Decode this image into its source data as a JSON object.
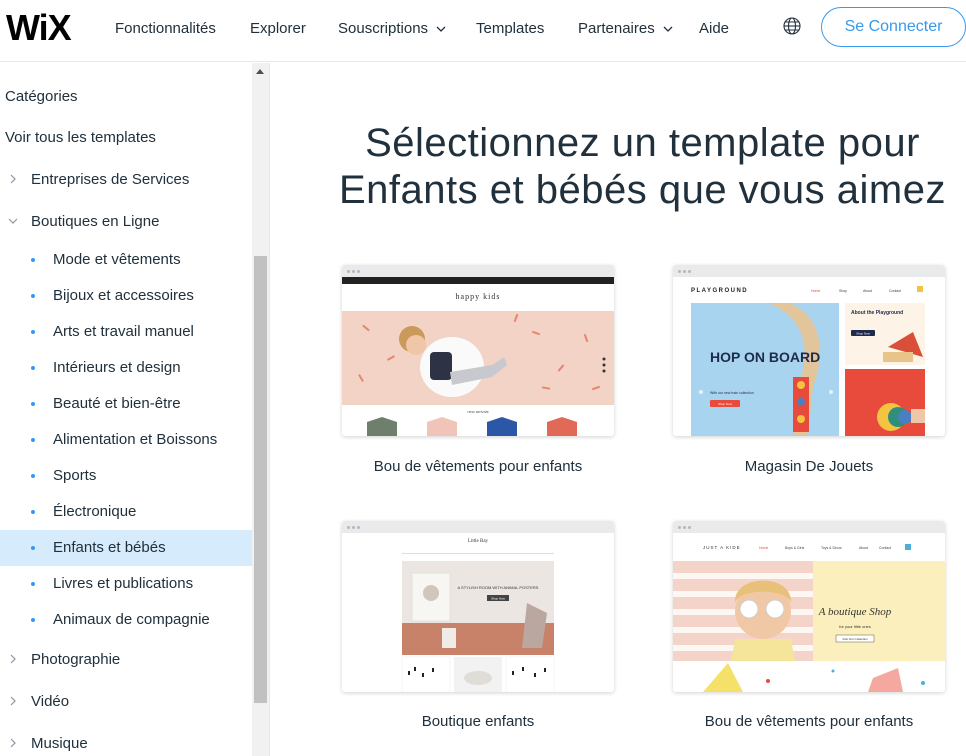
{
  "header": {
    "logo_text": "WiX",
    "nav": [
      "Fonctionnalités",
      "Explorer",
      "Souscriptions",
      "Templates",
      "Partenaires",
      "Aide"
    ],
    "connect_label": "Se Connecter"
  },
  "sidebar": {
    "categories_title": "Catégories",
    "all_templates": "Voir tous les templates",
    "items": [
      {
        "label": "Entreprises de Services",
        "expanded": false
      },
      {
        "label": "Boutiques en Ligne",
        "expanded": true
      },
      {
        "label": "Photographie",
        "expanded": false
      },
      {
        "label": "Vidéo",
        "expanded": false
      },
      {
        "label": "Musique",
        "expanded": false
      }
    ],
    "subitems": [
      "Mode et vêtements",
      "Bijoux et accessoires",
      "Arts et travail manuel",
      "Intérieurs et design",
      "Beauté et bien-être",
      "Alimentation et Boissons",
      "Sports",
      "Électronique",
      "Enfants et bébés",
      "Livres et publications",
      "Animaux de compagnie"
    ],
    "active_subitem": "Enfants et bébés"
  },
  "main": {
    "title_line1": "Sélectionnez un template pour",
    "title_line2": "Enfants et bébés que vous aimez",
    "templates": [
      {
        "label": "Bou de vêtements pour enfants",
        "preview": {
          "brand": "happy kids",
          "section": "new arrivals"
        }
      },
      {
        "label": "Magasin De Jouets",
        "preview": {
          "brand": "PLAYGROUND",
          "nav": [
            "Home",
            "Shop",
            "About",
            "Contact"
          ],
          "hero": "HOP ON BOARD",
          "hero_sub": "With our new train collection",
          "cta": "Shop Now",
          "side_title": "About the Playground",
          "side_cta": "Shop Now"
        }
      },
      {
        "label": "Boutique enfants",
        "preview": {
          "brand": "Little Bay",
          "hero": "A STYLISH ROOM WITH ANIMAL POSTERS",
          "cta": "Shop Now"
        }
      },
      {
        "label": "Bou de vêtements pour enfants",
        "preview": {
          "brand": "JUST A KIDE",
          "nav": [
            "Home",
            "Boys & Girls",
            "Toys & Decor",
            "About",
            "Contact"
          ],
          "hero": "A boutique Shop",
          "hero_sub": "for your little ones",
          "cta": "Visit Our Collection"
        }
      }
    ]
  },
  "colors": {
    "accent": "#3899ec",
    "active_bg": "#d6ebfb",
    "text": "#20303c"
  }
}
